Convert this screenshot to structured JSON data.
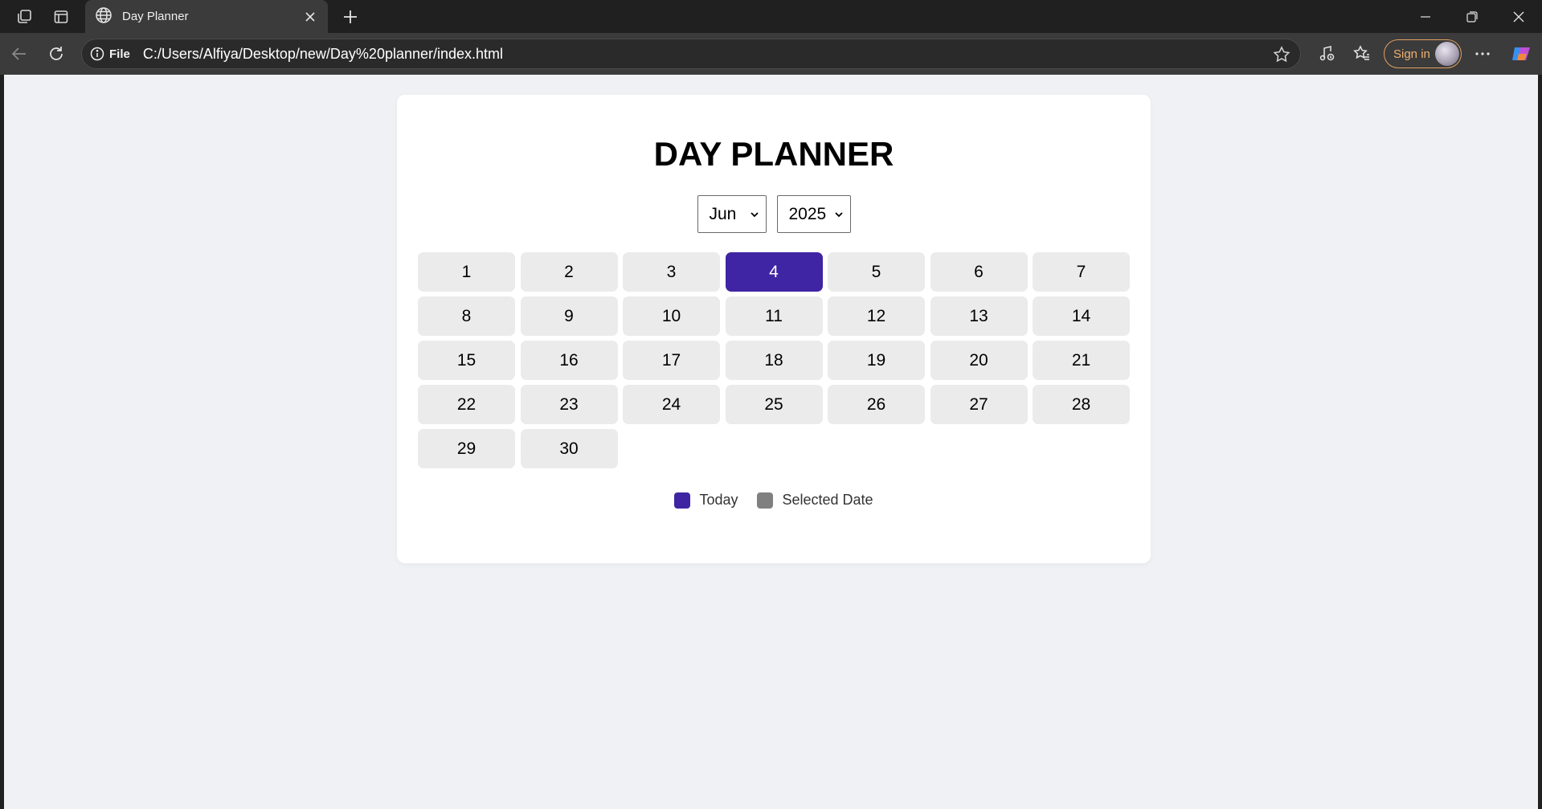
{
  "browser": {
    "tab_title": "Day Planner",
    "url_chip": "File",
    "url": "C:/Users/Alfiya/Desktop/new/Day%20planner/index.html",
    "sign_in_label": "Sign in"
  },
  "planner": {
    "title": "DAY PLANNER",
    "month_select": {
      "value": "Jun"
    },
    "year_select": {
      "value": "2025"
    },
    "days": [
      "1",
      "2",
      "3",
      "4",
      "5",
      "6",
      "7",
      "8",
      "9",
      "10",
      "11",
      "12",
      "13",
      "14",
      "15",
      "16",
      "17",
      "18",
      "19",
      "20",
      "21",
      "22",
      "23",
      "24",
      "25",
      "26",
      "27",
      "28",
      "29",
      "30"
    ],
    "today": "4",
    "legend": {
      "today_label": "Today",
      "selected_label": "Selected Date"
    }
  },
  "colors": {
    "today": "#3f25a3",
    "selected": "#808080",
    "day_bg": "#ebebeb",
    "page_bg": "#f0f1f4"
  }
}
